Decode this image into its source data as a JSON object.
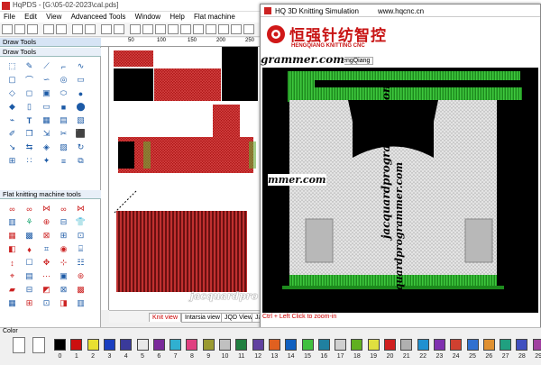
{
  "app": {
    "title": "HqPDS - [G:\\05-02-2023\\cal.pds]"
  },
  "menu": [
    "File",
    "Edit",
    "View",
    "Advanceed Tools",
    "Window",
    "Help",
    "Flat machine"
  ],
  "panels": {
    "title": "Draw Tools",
    "section1": "Draw Tools",
    "section2": "Flat knitting machine tools"
  },
  "canvas_tabs": [
    "Knit view",
    "Intarsia view",
    "JQD View",
    "Ja"
  ],
  "ruler": {
    "labels": [
      "50",
      "100",
      "150",
      "200",
      "250"
    ]
  },
  "sim": {
    "title": "HQ 3D Knitting Simulation",
    "url": "www.hqcnc.cn",
    "brand_cn": "恒强针纺智控",
    "brand_en": "HENGQIANG KNITTING CNC",
    "tab": "HengQiang",
    "status": "Ctrl + Left Click to zoom-in"
  },
  "watermarks": [
    "grammer.com",
    "mmer.com",
    "jacquardprogrammer.com",
    "jacquardprogrammer.com",
    "jacquardpro"
  ],
  "color_bar": {
    "label": "Color",
    "numbers": [
      "0",
      "1",
      "2",
      "3",
      "4",
      "5",
      "6",
      "7",
      "8",
      "9",
      "10",
      "11",
      "12",
      "13",
      "14",
      "15",
      "16",
      "17",
      "18",
      "19",
      "20",
      "21",
      "22",
      "23",
      "24",
      "25",
      "26",
      "27",
      "28",
      "29"
    ],
    "colors": [
      "#000000",
      "#cc1010",
      "#e8e030",
      "#1a3fc0",
      "#3a3a9a",
      "#e8e8e8",
      "#7a2a9a",
      "#30b0d0",
      "#e04080",
      "#9a9a30",
      "#c0c0c0",
      "#208040",
      "#6040a0",
      "#e06020",
      "#1060c0",
      "#40c040",
      "#2080a0",
      "#d0d0d0",
      "#60b020",
      "#e0e040",
      "#d02020",
      "#b0b0b0",
      "#2090d0",
      "#8030b0",
      "#d04030",
      "#3070d0",
      "#e09030",
      "#20a080",
      "#4050c0",
      "#a040a0"
    ]
  }
}
